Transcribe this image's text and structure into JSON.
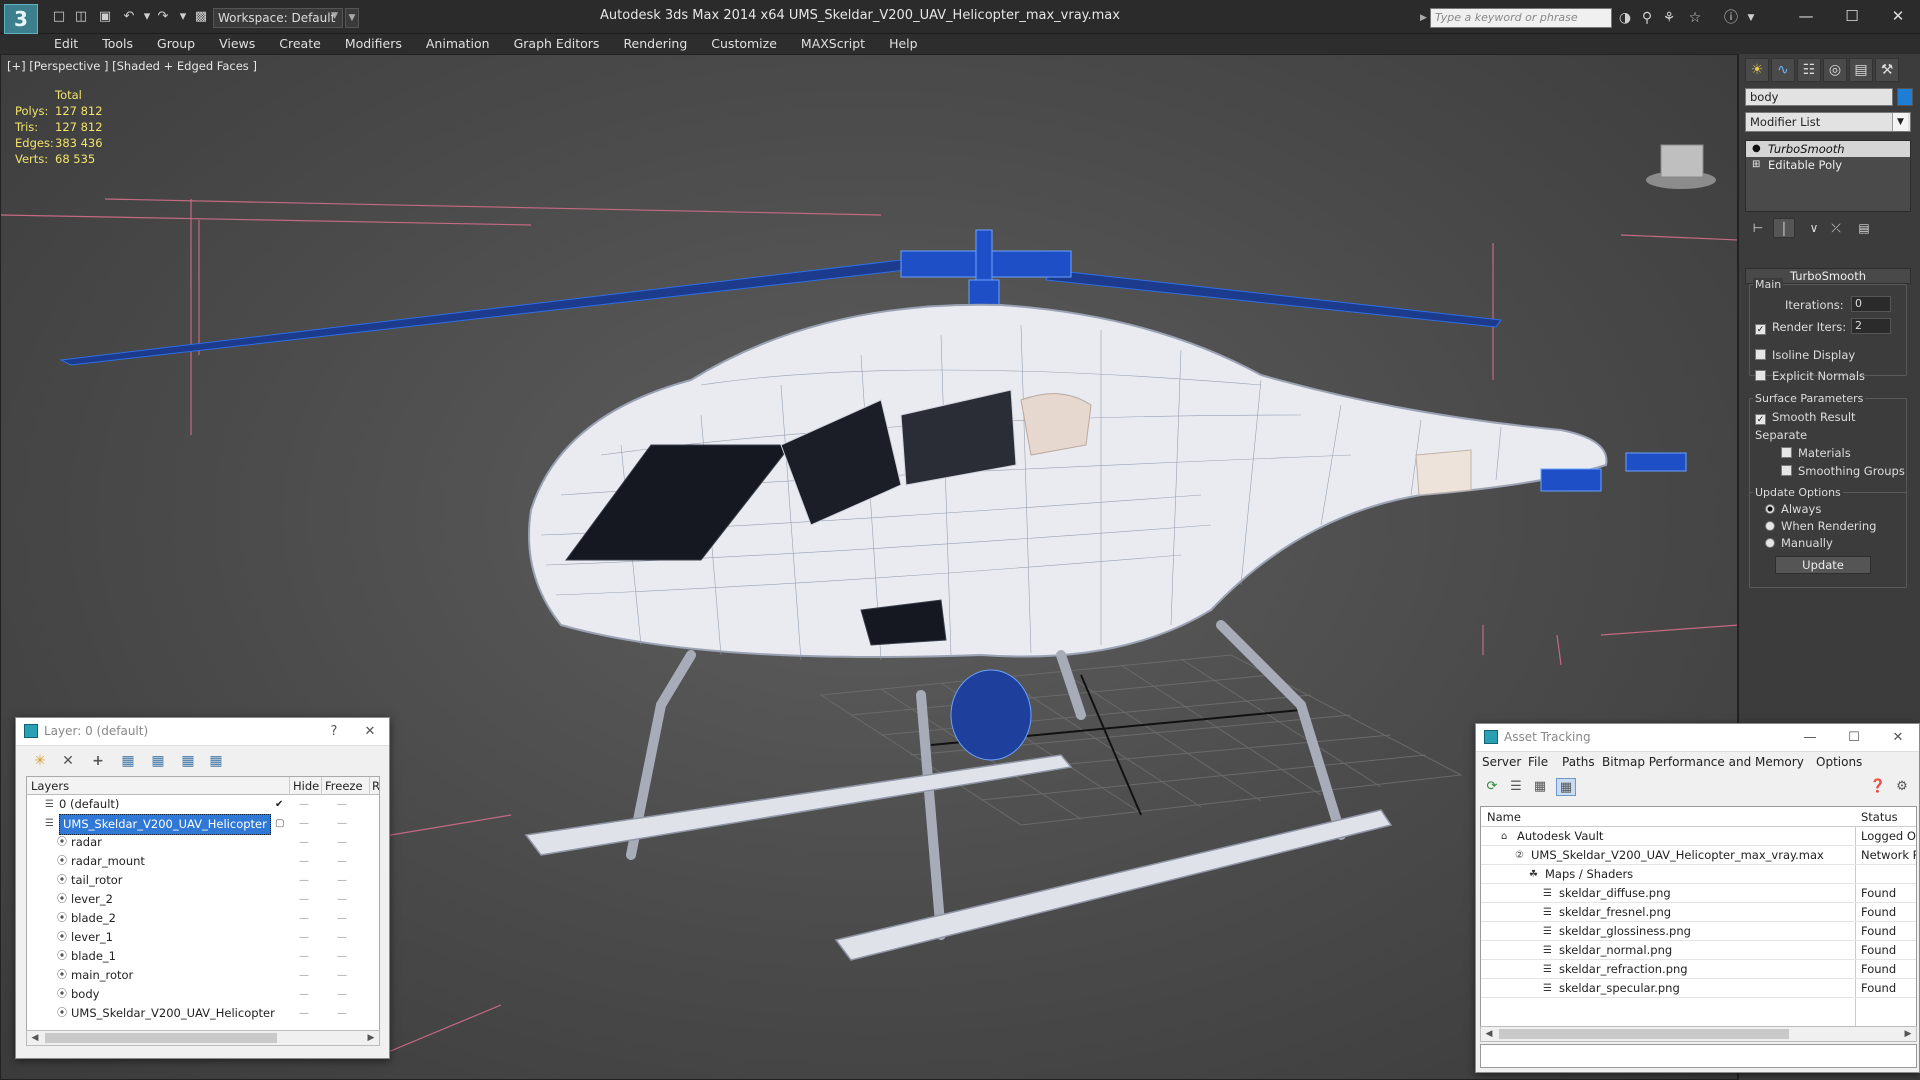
{
  "title_bar": {
    "app_title": "Autodesk 3ds Max  2014 x64      UMS_Skeldar_V200_UAV_Helicopter_max_vray.max",
    "workspace": "Workspace: Default",
    "search_placeholder": "Type a keyword or phrase"
  },
  "menu": [
    "Edit",
    "Tools",
    "Group",
    "Views",
    "Create",
    "Modifiers",
    "Animation",
    "Graph Editors",
    "Rendering",
    "Customize",
    "MAXScript",
    "Help"
  ],
  "viewport": {
    "label": "[+] [Perspective ] [Shaded + Edged Faces ]",
    "stats": {
      "header": "Total",
      "rows": [
        {
          "label": "Polys:",
          "value": "127 812"
        },
        {
          "label": "Tris:",
          "value": "127 812"
        },
        {
          "label": "Edges:",
          "value": "383 436"
        },
        {
          "label": "Verts:",
          "value": "68 535"
        }
      ]
    }
  },
  "command_panel": {
    "object_name": "body",
    "object_color": "#1e7ed6",
    "modifier_list": "Modifier List",
    "stack": [
      "TurboSmooth",
      "Editable Poly"
    ],
    "rollout_title": "TurboSmooth",
    "main_group": "Main",
    "iterations_label": "Iterations:",
    "iterations_value": "0",
    "render_iters_label": "Render Iters:",
    "render_iters_value": "2",
    "isoline_display": "Isoline Display",
    "explicit_normals": "Explicit Normals",
    "surface_params": "Surface Parameters",
    "smooth_result": "Smooth Result",
    "separate": "Separate",
    "materials": "Materials",
    "smoothing_groups": "Smoothing Groups",
    "update_options": "Update Options",
    "always": "Always",
    "when_rendering": "When Rendering",
    "manually": "Manually",
    "update_button": "Update"
  },
  "layer_window": {
    "title": "Layer: 0 (default)",
    "help": "?",
    "columns": {
      "layers": "Layers",
      "hide": "Hide",
      "freeze": "Freeze",
      "r": "R"
    },
    "rows": [
      {
        "name": "0 (default)",
        "level": 0
      },
      {
        "name": "UMS_Skeldar_V200_UAV_Helicopter",
        "level": 0
      },
      {
        "name": "radar",
        "level": 1
      },
      {
        "name": "radar_mount",
        "level": 1
      },
      {
        "name": "tail_rotor",
        "level": 1
      },
      {
        "name": "lever_2",
        "level": 1
      },
      {
        "name": "blade_2",
        "level": 1
      },
      {
        "name": "lever_1",
        "level": 1
      },
      {
        "name": "blade_1",
        "level": 1
      },
      {
        "name": "main_rotor",
        "level": 1
      },
      {
        "name": "body",
        "level": 1
      },
      {
        "name": "UMS_Skeldar_V200_UAV_Helicopter",
        "level": 1
      }
    ]
  },
  "asset_window": {
    "title": "Asset Tracking",
    "menu": [
      "Server",
      "File",
      "Paths",
      "Bitmap Performance and Memory",
      "Options"
    ],
    "columns": {
      "name": "Name",
      "status": "Status"
    },
    "rows": [
      {
        "name": "Autodesk Vault",
        "status": "Logged Out",
        "level": 0
      },
      {
        "name": "UMS_Skeldar_V200_UAV_Helicopter_max_vray.max",
        "status": "Network Path",
        "level": 1
      },
      {
        "name": "Maps / Shaders",
        "status": "",
        "level": 2
      },
      {
        "name": "skeldar_diffuse.png",
        "status": "Found",
        "level": 3
      },
      {
        "name": "skeldar_fresnel.png",
        "status": "Found",
        "level": 3
      },
      {
        "name": "skeldar_glossiness.png",
        "status": "Found",
        "level": 3
      },
      {
        "name": "skeldar_normal.png",
        "status": "Found",
        "level": 3
      },
      {
        "name": "skeldar_refraction.png",
        "status": "Found",
        "level": 3
      },
      {
        "name": "skeldar_specular.png",
        "status": "Found",
        "level": 3
      }
    ]
  }
}
